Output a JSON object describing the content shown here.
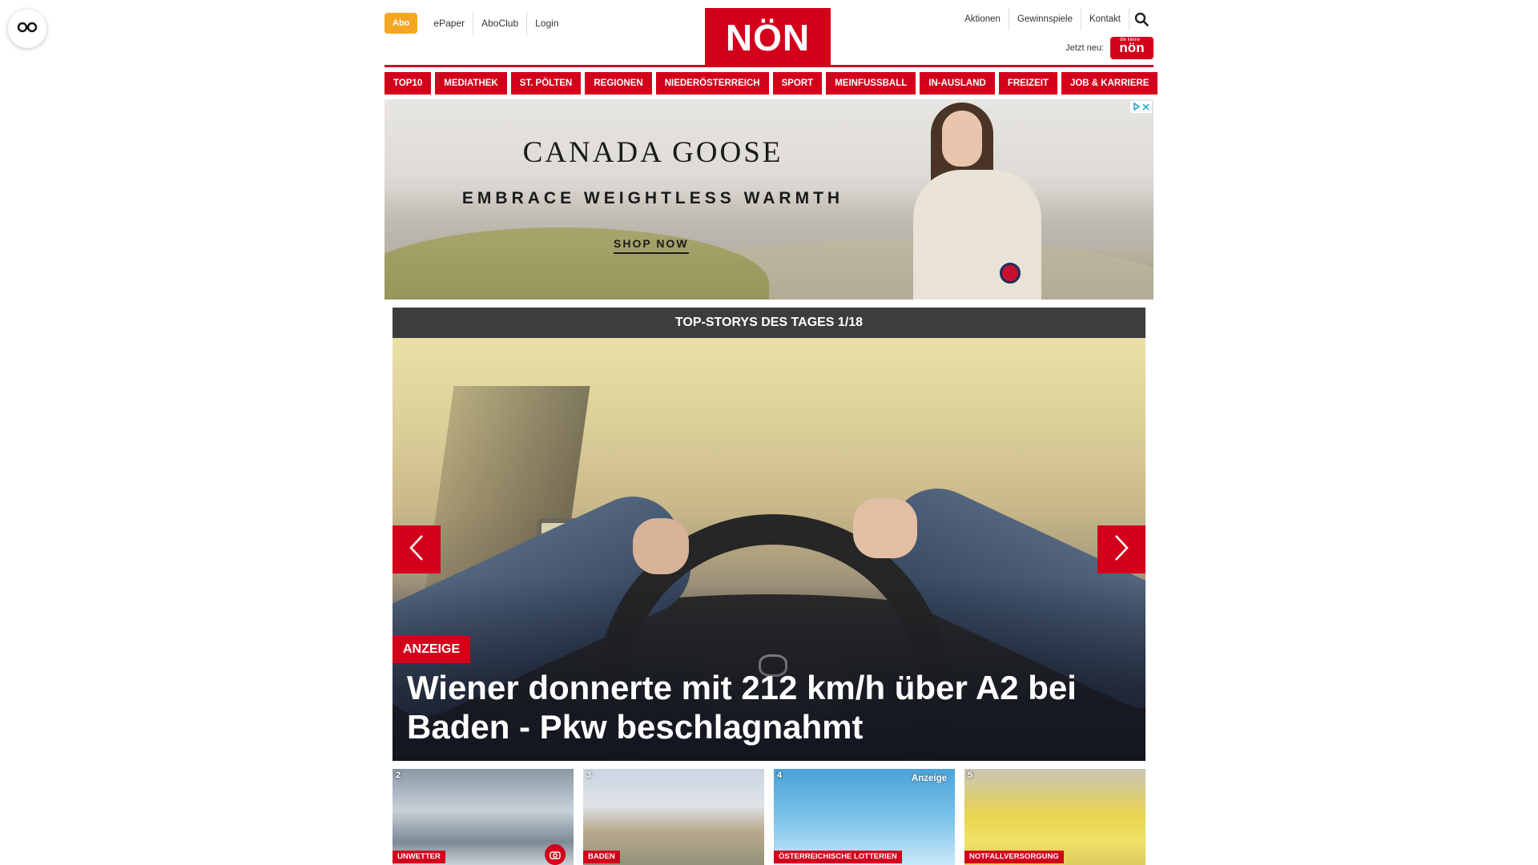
{
  "header": {
    "abo_label": "Abo",
    "left_links": [
      "ePaper",
      "AboClub",
      "Login"
    ],
    "logo_text": "NÖN",
    "right_links": [
      "Aktionen",
      "Gewinnspiele",
      "Kontakt"
    ],
    "jetzt_label": "Jetzt neu:",
    "kleine_badge_small": "die kleine",
    "kleine_badge_text": "nön"
  },
  "nav": {
    "items": [
      "TOP10",
      "MEDIATHEK",
      "ST. PÖLTEN",
      "REGIONEN",
      "NIEDERÖSTERREICH",
      "SPORT",
      "MEINFUSSBALL",
      "IN-AUSLAND",
      "FREIZEIT",
      "JOB & KARRIERE"
    ]
  },
  "ad": {
    "brand": "CANADA GOOSE",
    "slogan": "EMBRACE WEIGHTLESS WARMTH",
    "cta": "SHOP NOW"
  },
  "top_stories": {
    "header": "TOP-STORYS DES TAGES 1/18",
    "hero": {
      "tag": "ANZEIGE",
      "title": "Wiener donnerte mit 212 km/h über A2 bei Baden - Pkw beschlagnahmt"
    },
    "thumbs": [
      {
        "num": "2",
        "category": "UNWETTER",
        "ad_label": ""
      },
      {
        "num": "3",
        "category": "BADEN",
        "ad_label": ""
      },
      {
        "num": "4",
        "category": "ÖSTERREICHISCHE LOTTERIEN",
        "ad_label": "Anzeige"
      },
      {
        "num": "5",
        "category": "NOTFALLVERSORGUNG",
        "ad_label": ""
      }
    ]
  },
  "colors": {
    "brand_red": "#d3001c",
    "abo_orange": "#f5a623",
    "stories_header_bg": "#3d3d3d"
  },
  "icons": {
    "accessibility": "glasses-icon",
    "search": "search-icon",
    "prev": "chevron-left-icon",
    "next": "chevron-right-icon",
    "camera": "camera-icon",
    "ad_choices": "ad-choices-icon",
    "ad_close": "close-icon"
  }
}
